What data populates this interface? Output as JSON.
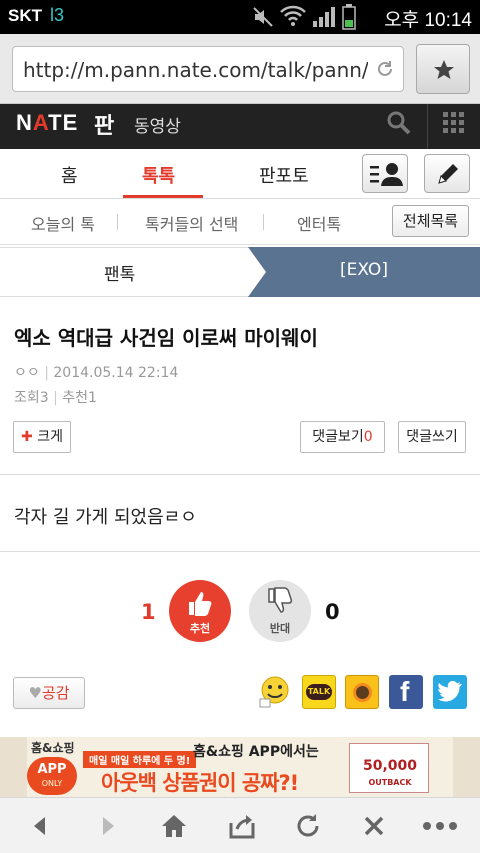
{
  "status_bar": {
    "carrier": "SKT",
    "network": "l3",
    "time": "오후 10:14"
  },
  "browser": {
    "url": "http://m.pann.nate.com/talk/pann/"
  },
  "header": {
    "logo": "NATE",
    "section": "판",
    "video_link": "동영상"
  },
  "main_tabs": [
    "홈",
    "톡톡",
    "판포토"
  ],
  "sub_tabs": [
    "오늘의 톡",
    "톡커들의 선택",
    "엔터톡"
  ],
  "all_list_label": "전체목록",
  "breadcrumb": {
    "category": "팬톡",
    "board": "[EXO]"
  },
  "article": {
    "title": "엑소 역대급 사건임 이로써 마이웨이",
    "author": "ㅇㅇ",
    "date": "2014.05.14 22:14",
    "views_label": "조회3",
    "recommend_label": "추천1",
    "body": "각자 길 가게 되었음ㄹㅇ"
  },
  "actions": {
    "enlarge": "크게",
    "view_comments": "댓글보기",
    "comment_count": "0",
    "write_comment": "댓글쓰기"
  },
  "votes": {
    "up_count": "1",
    "up_label": "추천",
    "down_count": "0",
    "down_label": "반대"
  },
  "like_label": "공감",
  "share_icons": [
    "emoticon-icon",
    "kakaotalk-icon",
    "kakaostory-icon",
    "facebook-icon",
    "twitter-icon"
  ],
  "banner": {
    "brand": "홈&쇼핑",
    "badge": "APP",
    "badge_sub": "ONLY",
    "promo_top": "매일 매일 하루에 두 명!",
    "promo_app": "홈&쇼핑 APP에서는",
    "promo_main": "아웃백 상품권이 공짜?!",
    "coupon_value": "50,000",
    "coupon_brand": "OUTBACK"
  },
  "colors": {
    "accent": "#e23b2b",
    "header_bg": "#222222",
    "crumb_blue": "#5a7391"
  }
}
